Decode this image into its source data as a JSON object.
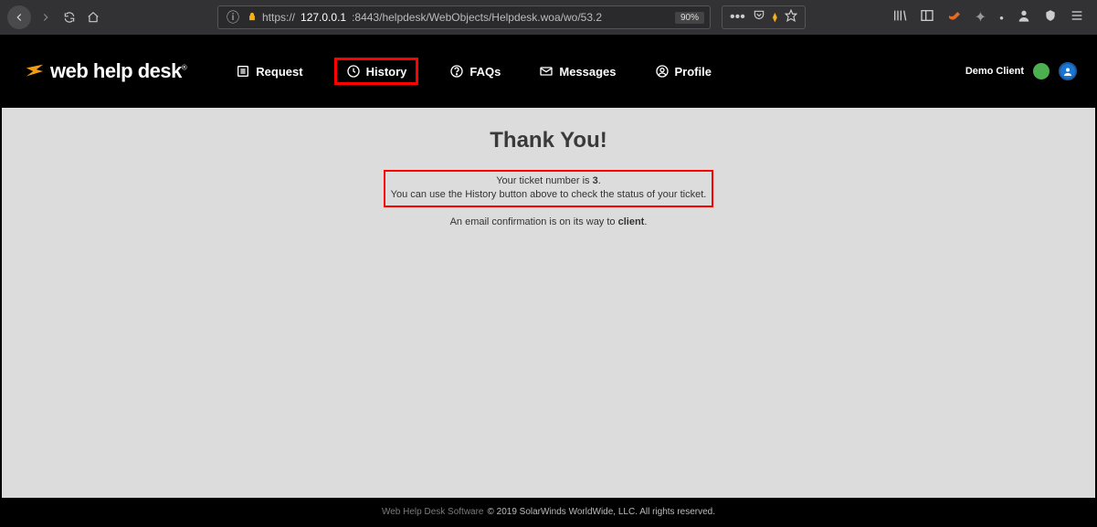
{
  "browser": {
    "url_prefix": "https://",
    "url_host": "127.0.0.1",
    "url_port_path": ":8443/helpdesk/WebObjects/Helpdesk.woa/wo/53.2",
    "zoom": "90%"
  },
  "logo": {
    "text": "web help desk",
    "tm": "®"
  },
  "nav": {
    "request": "Request",
    "history": "History",
    "faqs": "FAQs",
    "messages": "Messages",
    "profile": "Profile"
  },
  "user": {
    "name": "Demo Client"
  },
  "content": {
    "title": "Thank You!",
    "ticket_line_pre": "Your ticket number is ",
    "ticket_number": "3",
    "ticket_line_post": ".",
    "history_hint": "You can use the History button above to check the status of your ticket.",
    "email_pre": "An email confirmation is on its way to ",
    "email_target": "client",
    "email_post": "."
  },
  "footer": {
    "product": "Web Help Desk Software",
    "copyright": "© 2019 SolarWinds WorldWide, LLC. All rights reserved."
  }
}
